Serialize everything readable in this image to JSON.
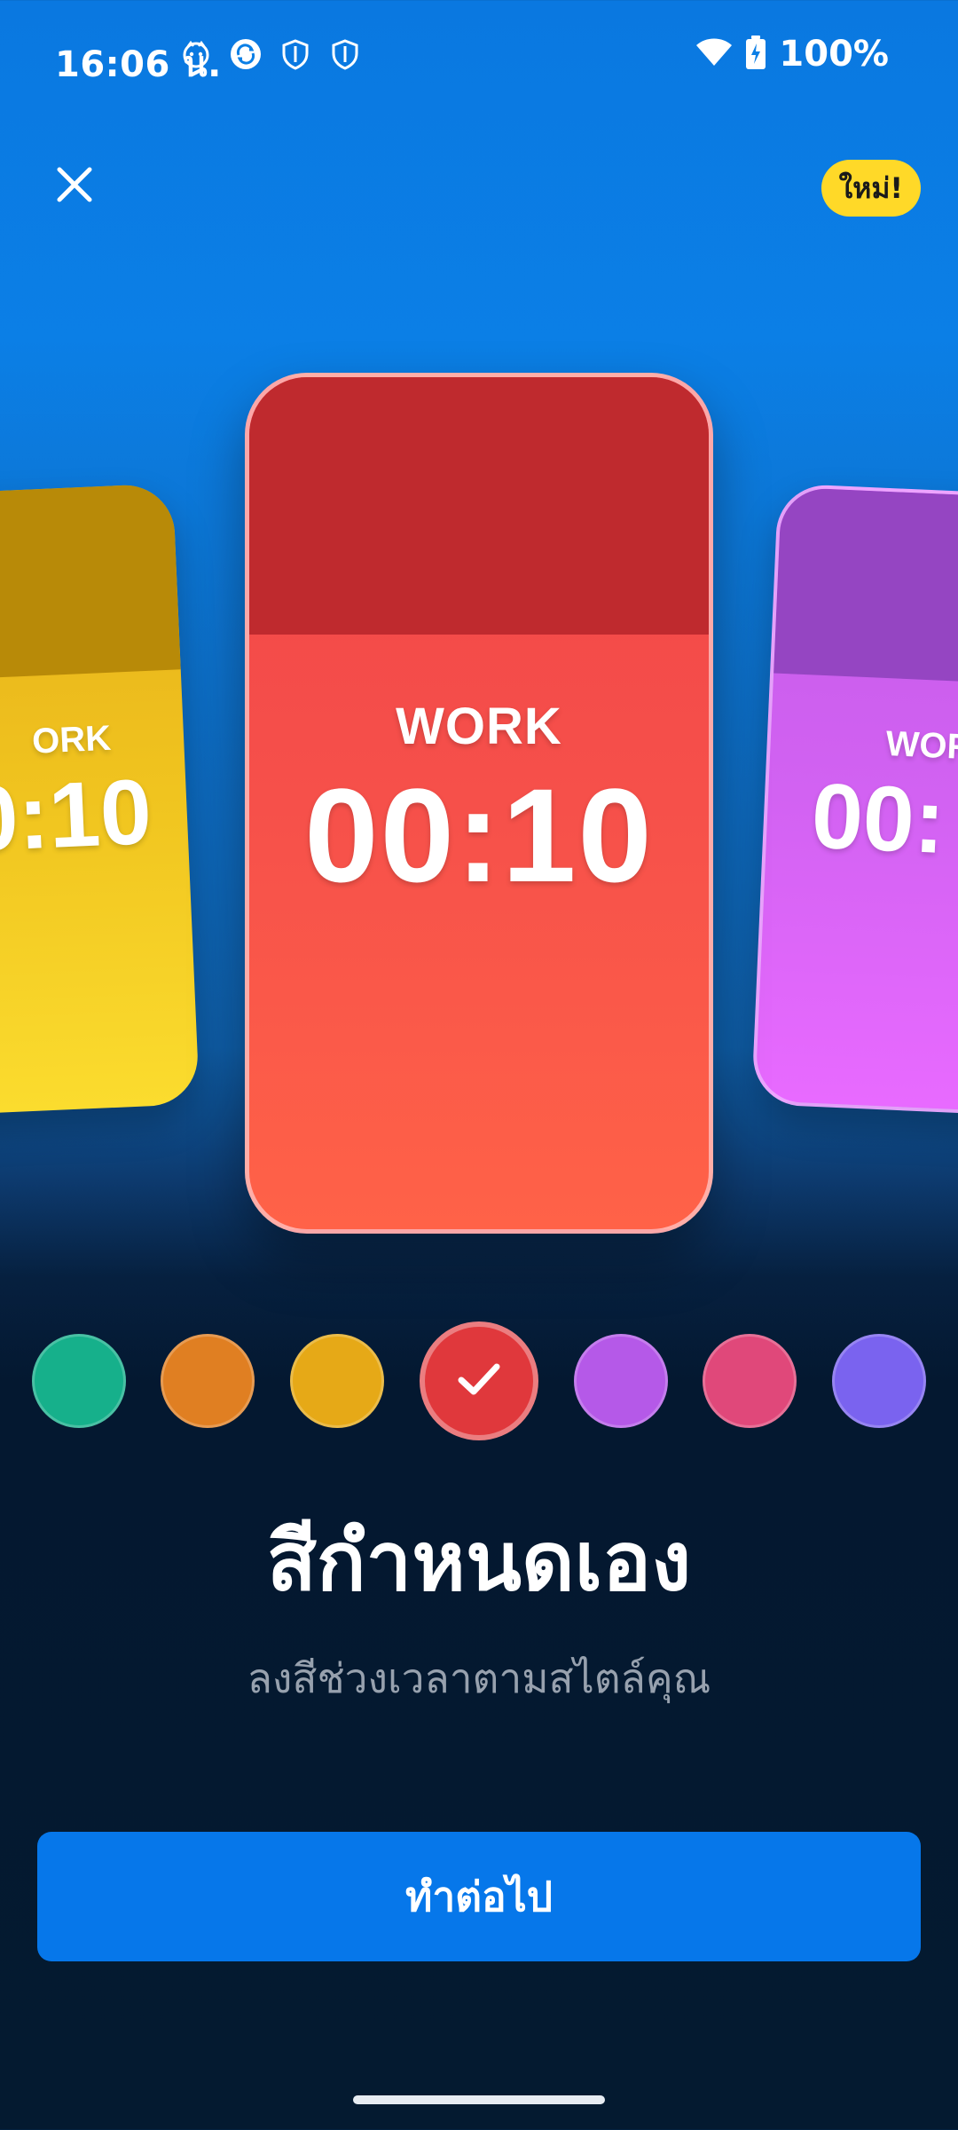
{
  "status_bar": {
    "time": "16:06 น.",
    "battery": "100%",
    "icons": [
      "notification-face-icon",
      "sync-icon",
      "shield-icon",
      "shield-icon",
      "wifi-icon",
      "battery-charging-icon"
    ]
  },
  "header": {
    "close_icon": "close-icon",
    "new_badge": "ใหม่!"
  },
  "preview_cards": [
    {
      "label": "ORK",
      "time": "0:10",
      "color": "#f0c41f"
    },
    {
      "label": "WORK",
      "time": "00:10",
      "color": "#f04448"
    },
    {
      "label": "WOR",
      "time": "00:",
      "color": "#d262f2"
    }
  ],
  "color_options": [
    {
      "name": "teal",
      "color": "#16b08b",
      "selected": false
    },
    {
      "name": "orange",
      "color": "#e07f22",
      "selected": false
    },
    {
      "name": "yellow",
      "color": "#e6a917",
      "selected": false
    },
    {
      "name": "red",
      "color": "#e0383c",
      "selected": true
    },
    {
      "name": "purple",
      "color": "#b559e8",
      "selected": false
    },
    {
      "name": "pink",
      "color": "#e0487a",
      "selected": false
    },
    {
      "name": "violet",
      "color": "#7a63ef",
      "selected": false
    }
  ],
  "content": {
    "title": "สีกำหนดเอง",
    "subtitle": "ลงสีช่วงเวลาตามสไตล์คุณ"
  },
  "actions": {
    "continue_label": "ทำต่อไป"
  }
}
